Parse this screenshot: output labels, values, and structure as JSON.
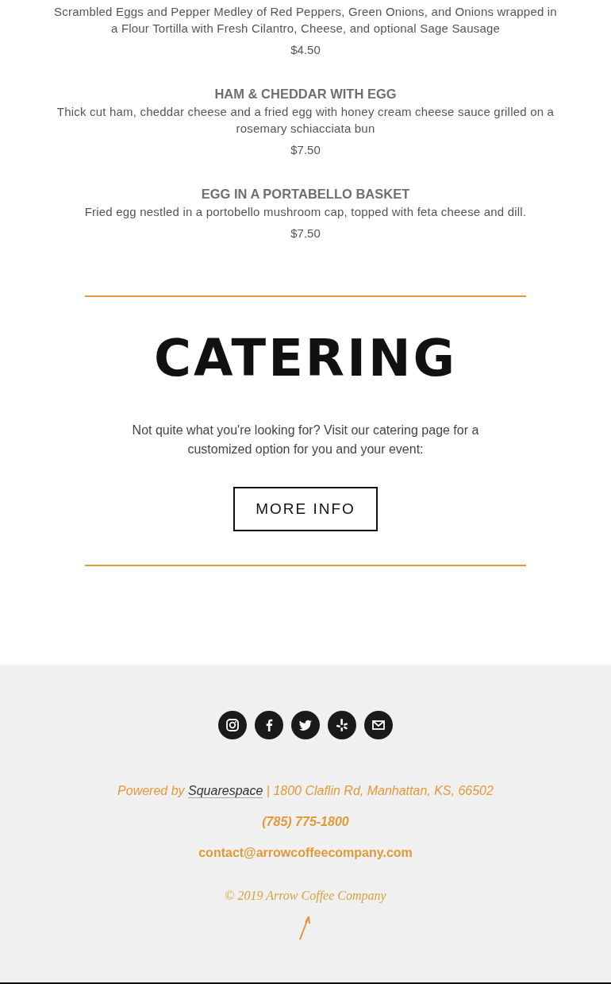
{
  "menu_items": [
    {
      "description": "Scrambled Eggs and Pepper Medley of Red Peppers, Green Onions, and Onions wrapped in a Flour Tortilla with Fresh Cilantro, Cheese, and optional Sage Sausage",
      "price": "$4.50"
    },
    {
      "name": "HAM & CHEDDAR WITH EGG",
      "description": "Thick cut ham, cheddar cheese and a fried egg with honey cream cheese sauce grilled on a rosemary schiacciata bun",
      "price": "$7.50"
    },
    {
      "name": "EGG IN A PORTABELLO BASKET",
      "description": "Fried egg nestled in a portobello mushroom cap, topped with feta cheese and dill.",
      "price": "$7.50"
    }
  ],
  "catering": {
    "heading": "CATERING",
    "text": "Not quite what you're looking for? Visit our catering page for a customized option for you and your event:",
    "button": "MORE INFO"
  },
  "footer": {
    "social_links": [
      {
        "kind": "instagram"
      },
      {
        "kind": "facebook"
      },
      {
        "kind": "twitter"
      },
      {
        "kind": "yelp"
      },
      {
        "kind": "email"
      }
    ],
    "powered_by": "Powered by",
    "platform_link": "Squarespace",
    "address": "| 1800 Claflin Rd, Manhattan, KS, 66502",
    "phone": "(785) 775-1800",
    "email": "contact@arrowcoffeecompany.com",
    "copyright": "© 2019 Arrow Coffee Company"
  }
}
